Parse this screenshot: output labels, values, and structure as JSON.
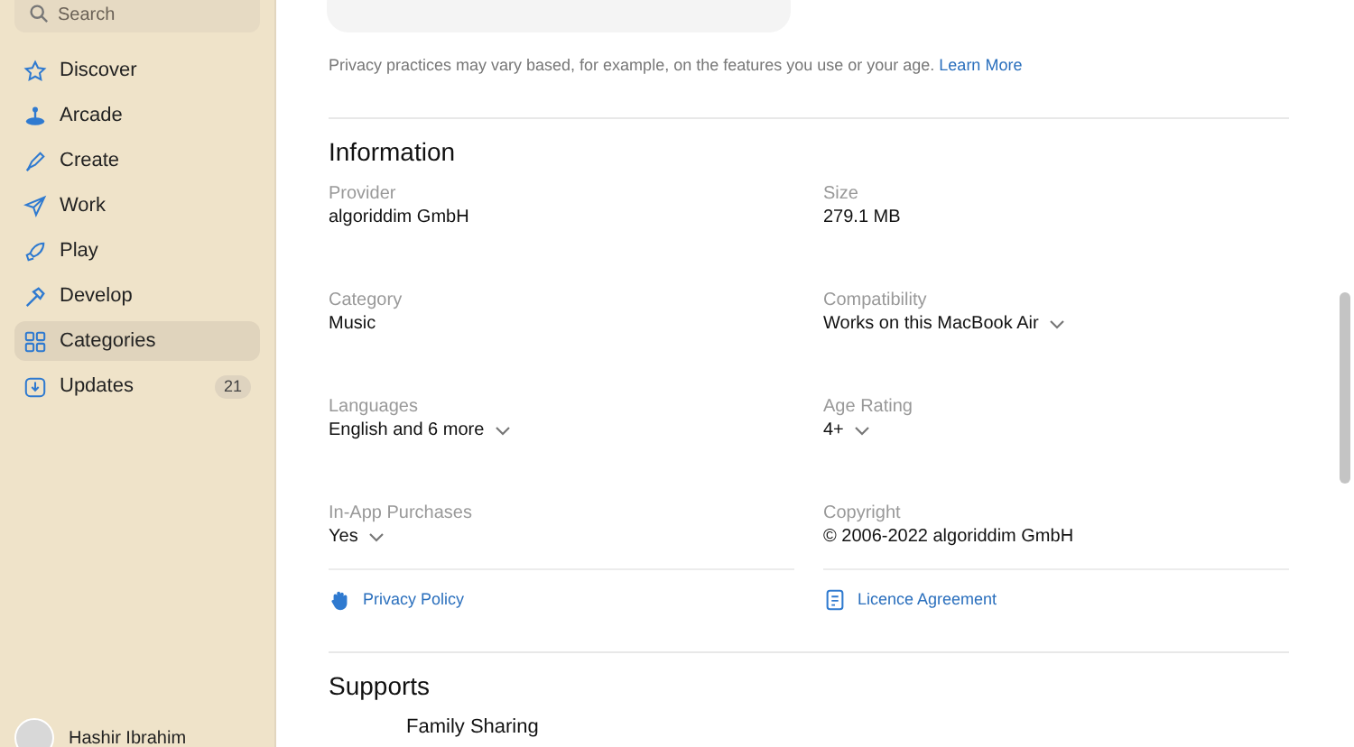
{
  "sidebar": {
    "search": {
      "placeholder": "Search"
    },
    "items": [
      {
        "label": "Discover",
        "selected": false
      },
      {
        "label": "Arcade",
        "selected": false
      },
      {
        "label": "Create",
        "selected": false
      },
      {
        "label": "Work",
        "selected": false
      },
      {
        "label": "Play",
        "selected": false
      },
      {
        "label": "Develop",
        "selected": false
      },
      {
        "label": "Categories",
        "selected": true
      },
      {
        "label": "Updates",
        "selected": false,
        "badge": "21"
      }
    ],
    "user": {
      "name": "Hashir Ibrahim"
    }
  },
  "privacy_note": {
    "text": "Privacy practices may vary based, for example, on the features you use or your age.",
    "link": "Learn More"
  },
  "information": {
    "title": "Information",
    "fields": [
      {
        "label": "Provider",
        "value": "algoriddim GmbH",
        "has_menu": false
      },
      {
        "label": "Size",
        "value": "279.1 MB",
        "has_menu": false
      },
      {
        "label": "Category",
        "value": "Music",
        "has_menu": false
      },
      {
        "label": "Compatibility",
        "value": "Works on this MacBook Air",
        "has_menu": true
      },
      {
        "label": "Languages",
        "value": "English and 6 more",
        "has_menu": true
      },
      {
        "label": "Age Rating",
        "value": "4+",
        "has_menu": true
      },
      {
        "label": "In-App Purchases",
        "value": "Yes",
        "has_menu": true
      },
      {
        "label": "Copyright",
        "value": "© 2006-2022 algoriddim GmbH",
        "has_menu": false
      }
    ],
    "links": [
      {
        "label": "Privacy Policy"
      },
      {
        "label": "Licence Agreement"
      }
    ]
  },
  "supports": {
    "title": "Supports",
    "items": [
      "Family Sharing"
    ]
  }
}
